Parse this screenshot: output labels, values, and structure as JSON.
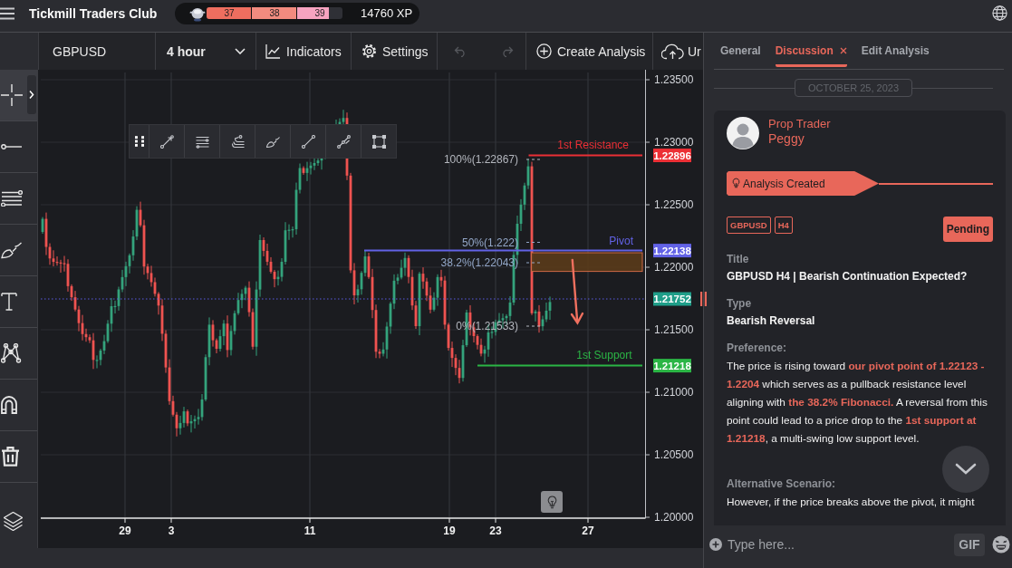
{
  "app_bar": {
    "title": "Tickmill Traders Club",
    "rank": {
      "level": 0.9,
      "segments": [
        "37",
        "38",
        "39"
      ]
    },
    "xp": "14760 XP"
  },
  "toolbar": {
    "symbol": "GBPUSD",
    "timeframe": "4 hour",
    "items": [
      {
        "kind": "indicators",
        "label": "Indicators",
        "disabled": false
      },
      {
        "kind": "settings",
        "label": "Settings",
        "disabled": false
      },
      {
        "kind": "undo",
        "disabled": true
      },
      {
        "kind": "redo",
        "disabled": true
      },
      {
        "kind": "create",
        "label": "Create Analysis",
        "disabled": false
      },
      {
        "kind": "upload",
        "label": "Ur",
        "disabled": false
      }
    ]
  },
  "drawing_tools": [
    {
      "kind": "crosshair",
      "selected": true
    },
    {
      "kind": "horizontal-line",
      "selected": false
    },
    {
      "kind": "parallel-lines",
      "selected": false
    },
    {
      "kind": "brush",
      "selected": false
    },
    {
      "kind": "text",
      "selected": false
    },
    {
      "kind": "nodes",
      "selected": false
    },
    {
      "kind": "magnet",
      "selected": false
    },
    {
      "kind": "trash",
      "selected": false
    }
  ],
  "floating_toolbar": [
    {
      "kind": "grip"
    },
    {
      "kind": "arrow-line"
    },
    {
      "kind": "lines"
    },
    {
      "kind": "curves"
    },
    {
      "kind": "brush"
    },
    {
      "kind": "line"
    },
    {
      "kind": "nodes-line"
    },
    {
      "kind": "rectangle"
    }
  ],
  "chart": {
    "price_ticks": [
      "1.23500",
      "1.23000",
      "1.22500",
      "1.22000",
      "1.21500",
      "1.21000",
      "1.20500",
      "1.20000"
    ],
    "date_ticks": [
      "29",
      "3",
      "11",
      "19",
      "23",
      "27"
    ],
    "levels": [
      {
        "label": "1st Resistance",
        "price": "1.22896",
        "color": "#ec2f35"
      },
      {
        "label": "Pivot",
        "price": "1.22138",
        "color": "#6262e6"
      },
      {
        "label": "1st Support",
        "price": "1.21218",
        "color": "#2bb545"
      }
    ],
    "last_price": {
      "price": "1.21752",
      "color": "#1f9e89"
    },
    "fib_labels": [
      {
        "text": "100%(1.22867)",
        "color": "#b4b7be"
      },
      {
        "text": "50%(1.222)",
        "color": "#93a7c8"
      },
      {
        "text": "38.2%(1.22043)",
        "color": "#93a7c8"
      },
      {
        "text": "0%(1.21533)",
        "color": "#b4b7be"
      }
    ]
  },
  "panel": {
    "tabs": [
      {
        "label": "General",
        "selected": false,
        "closable": false
      },
      {
        "label": "Discussion",
        "selected": true,
        "closable": true
      },
      {
        "label": "Edit Analysis",
        "selected": false,
        "closable": false
      }
    ],
    "date": "OCTOBER 25, 2023",
    "post": {
      "role": "Prop Trader",
      "author": "Peggy",
      "event": "Analysis Created",
      "tags": [
        "GBPUSD",
        "H4"
      ],
      "status": "Pending",
      "fields": [
        {
          "kind": "heading",
          "label": "Title",
          "value": "GBPUSD H4 | Bearish Continuation Expected?"
        },
        {
          "kind": "heading",
          "label": "Type",
          "value": "Bearish Reversal"
        },
        {
          "kind": "paragraph",
          "label": "Preference:",
          "value": "The price is rising toward **our pivot point of 1.22123 - 1.2204** which serves as a pullback resistance level aligning with **the 38.2% Fibonacci.** A reversal from this point could lead to a price drop to the **1st support at 1.21218**, a multi-swing low support level."
        },
        {
          "kind": "paragraph",
          "label": "Alternative Scenario:",
          "value": "However, if the price breaks above the pivot, it might"
        }
      ]
    },
    "composer": {
      "placeholder": "Type here...",
      "gif": "GIF"
    }
  }
}
